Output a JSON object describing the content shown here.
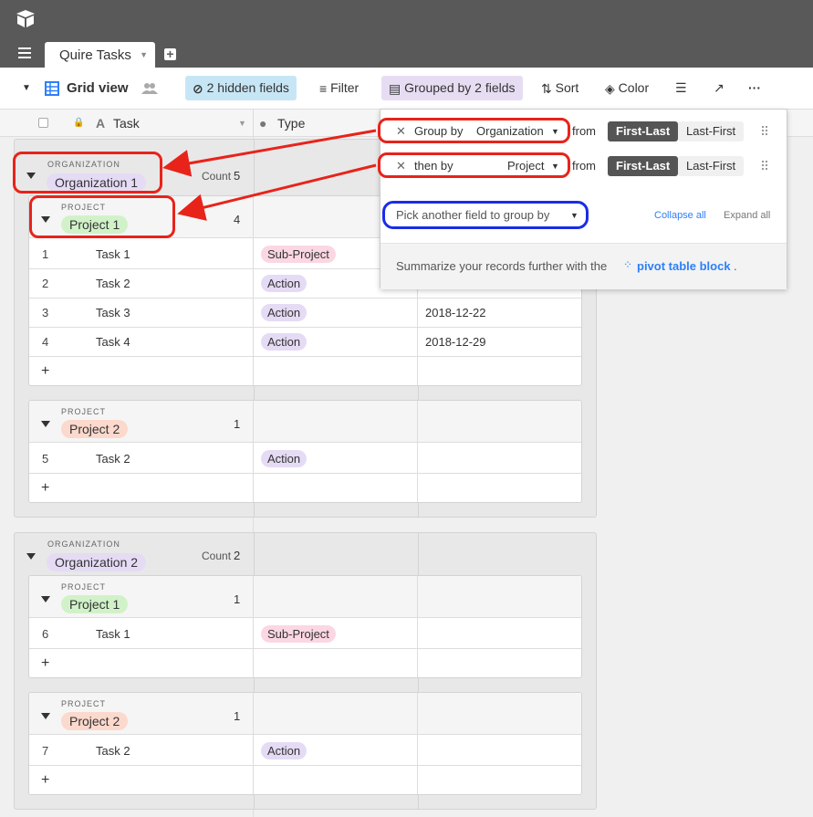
{
  "app": {
    "tab_name": "Quire Tasks"
  },
  "toolbar": {
    "view_name": "Grid view",
    "hidden_fields": "2 hidden fields",
    "filter": "Filter",
    "grouped": "Grouped by 2 fields",
    "sort": "Sort",
    "color": "Color"
  },
  "columns": {
    "task": "Task",
    "type": "Type"
  },
  "org_label": "ORGANIZATION",
  "project_label": "PROJECT",
  "count_label": "Count",
  "groups": [
    {
      "org": "Organization 1",
      "count": "5",
      "projects": [
        {
          "name": "Project 1",
          "count": "4",
          "rows": [
            {
              "num": "1",
              "task": "Task 1",
              "type": "Sub-Project",
              "date": ""
            },
            {
              "num": "2",
              "task": "Task 2",
              "type": "Action",
              "date": ""
            },
            {
              "num": "3",
              "task": "Task 3",
              "type": "Action",
              "date": "2018-12-22"
            },
            {
              "num": "4",
              "task": "Task 4",
              "type": "Action",
              "date": "2018-12-29"
            }
          ]
        },
        {
          "name": "Project 2",
          "count": "1",
          "rows": [
            {
              "num": "5",
              "task": "Task 2",
              "type": "Action",
              "date": ""
            }
          ]
        }
      ]
    },
    {
      "org": "Organization 2",
      "count": "2",
      "projects": [
        {
          "name": "Project 1",
          "count": "1",
          "rows": [
            {
              "num": "6",
              "task": "Task 1",
              "type": "Sub-Project",
              "date": ""
            }
          ]
        },
        {
          "name": "Project 2",
          "count": "1",
          "rows": [
            {
              "num": "7",
              "task": "Task 2",
              "type": "Action",
              "date": ""
            }
          ]
        }
      ]
    }
  ],
  "popover": {
    "row1_prefix": "Group by",
    "row1_field": "Organization",
    "row2_prefix": "then by",
    "row2_field": "Project",
    "from": "from",
    "first_last": "First-Last",
    "last_first": "Last-First",
    "pick_another": "Pick another field to group by",
    "collapse_all": "Collapse all",
    "expand_all": "Expand all",
    "footer_text": "Summarize your records further with the",
    "footer_link": "pivot table block",
    "footer_end": "."
  },
  "add_row": "+",
  "colors": {
    "topbar": "#595959",
    "annotation_red": "#e8231a",
    "annotation_blue": "#1a2de8",
    "accent_blue": "#2d7ff9"
  }
}
